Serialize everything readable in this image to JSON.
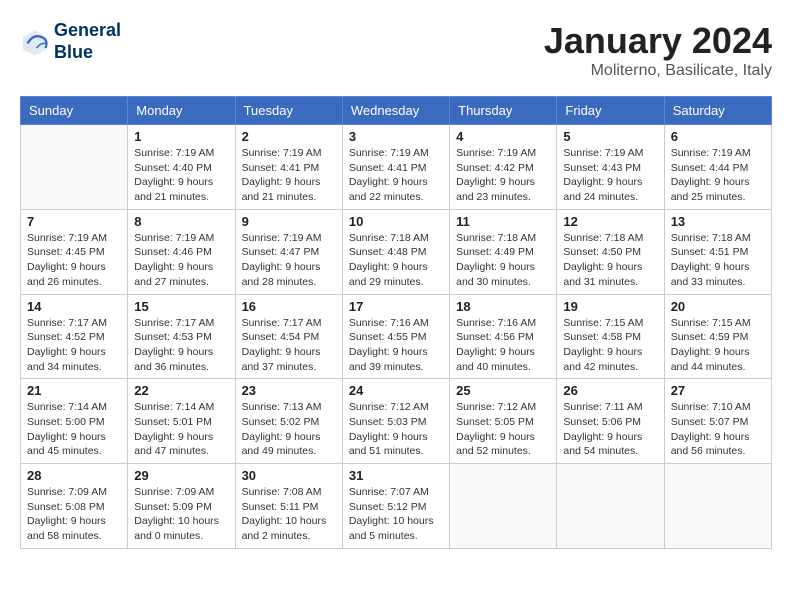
{
  "header": {
    "logo_line1": "General",
    "logo_line2": "Blue",
    "month_title": "January 2024",
    "location": "Moliterno, Basilicate, Italy"
  },
  "weekdays": [
    "Sunday",
    "Monday",
    "Tuesday",
    "Wednesday",
    "Thursday",
    "Friday",
    "Saturday"
  ],
  "weeks": [
    [
      {
        "day": "",
        "info": ""
      },
      {
        "day": "1",
        "info": "Sunrise: 7:19 AM\nSunset: 4:40 PM\nDaylight: 9 hours\nand 21 minutes."
      },
      {
        "day": "2",
        "info": "Sunrise: 7:19 AM\nSunset: 4:41 PM\nDaylight: 9 hours\nand 21 minutes."
      },
      {
        "day": "3",
        "info": "Sunrise: 7:19 AM\nSunset: 4:41 PM\nDaylight: 9 hours\nand 22 minutes."
      },
      {
        "day": "4",
        "info": "Sunrise: 7:19 AM\nSunset: 4:42 PM\nDaylight: 9 hours\nand 23 minutes."
      },
      {
        "day": "5",
        "info": "Sunrise: 7:19 AM\nSunset: 4:43 PM\nDaylight: 9 hours\nand 24 minutes."
      },
      {
        "day": "6",
        "info": "Sunrise: 7:19 AM\nSunset: 4:44 PM\nDaylight: 9 hours\nand 25 minutes."
      }
    ],
    [
      {
        "day": "7",
        "info": "Sunrise: 7:19 AM\nSunset: 4:45 PM\nDaylight: 9 hours\nand 26 minutes."
      },
      {
        "day": "8",
        "info": "Sunrise: 7:19 AM\nSunset: 4:46 PM\nDaylight: 9 hours\nand 27 minutes."
      },
      {
        "day": "9",
        "info": "Sunrise: 7:19 AM\nSunset: 4:47 PM\nDaylight: 9 hours\nand 28 minutes."
      },
      {
        "day": "10",
        "info": "Sunrise: 7:18 AM\nSunset: 4:48 PM\nDaylight: 9 hours\nand 29 minutes."
      },
      {
        "day": "11",
        "info": "Sunrise: 7:18 AM\nSunset: 4:49 PM\nDaylight: 9 hours\nand 30 minutes."
      },
      {
        "day": "12",
        "info": "Sunrise: 7:18 AM\nSunset: 4:50 PM\nDaylight: 9 hours\nand 31 minutes."
      },
      {
        "day": "13",
        "info": "Sunrise: 7:18 AM\nSunset: 4:51 PM\nDaylight: 9 hours\nand 33 minutes."
      }
    ],
    [
      {
        "day": "14",
        "info": "Sunrise: 7:17 AM\nSunset: 4:52 PM\nDaylight: 9 hours\nand 34 minutes."
      },
      {
        "day": "15",
        "info": "Sunrise: 7:17 AM\nSunset: 4:53 PM\nDaylight: 9 hours\nand 36 minutes."
      },
      {
        "day": "16",
        "info": "Sunrise: 7:17 AM\nSunset: 4:54 PM\nDaylight: 9 hours\nand 37 minutes."
      },
      {
        "day": "17",
        "info": "Sunrise: 7:16 AM\nSunset: 4:55 PM\nDaylight: 9 hours\nand 39 minutes."
      },
      {
        "day": "18",
        "info": "Sunrise: 7:16 AM\nSunset: 4:56 PM\nDaylight: 9 hours\nand 40 minutes."
      },
      {
        "day": "19",
        "info": "Sunrise: 7:15 AM\nSunset: 4:58 PM\nDaylight: 9 hours\nand 42 minutes."
      },
      {
        "day": "20",
        "info": "Sunrise: 7:15 AM\nSunset: 4:59 PM\nDaylight: 9 hours\nand 44 minutes."
      }
    ],
    [
      {
        "day": "21",
        "info": "Sunrise: 7:14 AM\nSunset: 5:00 PM\nDaylight: 9 hours\nand 45 minutes."
      },
      {
        "day": "22",
        "info": "Sunrise: 7:14 AM\nSunset: 5:01 PM\nDaylight: 9 hours\nand 47 minutes."
      },
      {
        "day": "23",
        "info": "Sunrise: 7:13 AM\nSunset: 5:02 PM\nDaylight: 9 hours\nand 49 minutes."
      },
      {
        "day": "24",
        "info": "Sunrise: 7:12 AM\nSunset: 5:03 PM\nDaylight: 9 hours\nand 51 minutes."
      },
      {
        "day": "25",
        "info": "Sunrise: 7:12 AM\nSunset: 5:05 PM\nDaylight: 9 hours\nand 52 minutes."
      },
      {
        "day": "26",
        "info": "Sunrise: 7:11 AM\nSunset: 5:06 PM\nDaylight: 9 hours\nand 54 minutes."
      },
      {
        "day": "27",
        "info": "Sunrise: 7:10 AM\nSunset: 5:07 PM\nDaylight: 9 hours\nand 56 minutes."
      }
    ],
    [
      {
        "day": "28",
        "info": "Sunrise: 7:09 AM\nSunset: 5:08 PM\nDaylight: 9 hours\nand 58 minutes."
      },
      {
        "day": "29",
        "info": "Sunrise: 7:09 AM\nSunset: 5:09 PM\nDaylight: 10 hours\nand 0 minutes."
      },
      {
        "day": "30",
        "info": "Sunrise: 7:08 AM\nSunset: 5:11 PM\nDaylight: 10 hours\nand 2 minutes."
      },
      {
        "day": "31",
        "info": "Sunrise: 7:07 AM\nSunset: 5:12 PM\nDaylight: 10 hours\nand 5 minutes."
      },
      {
        "day": "",
        "info": ""
      },
      {
        "day": "",
        "info": ""
      },
      {
        "day": "",
        "info": ""
      }
    ]
  ]
}
